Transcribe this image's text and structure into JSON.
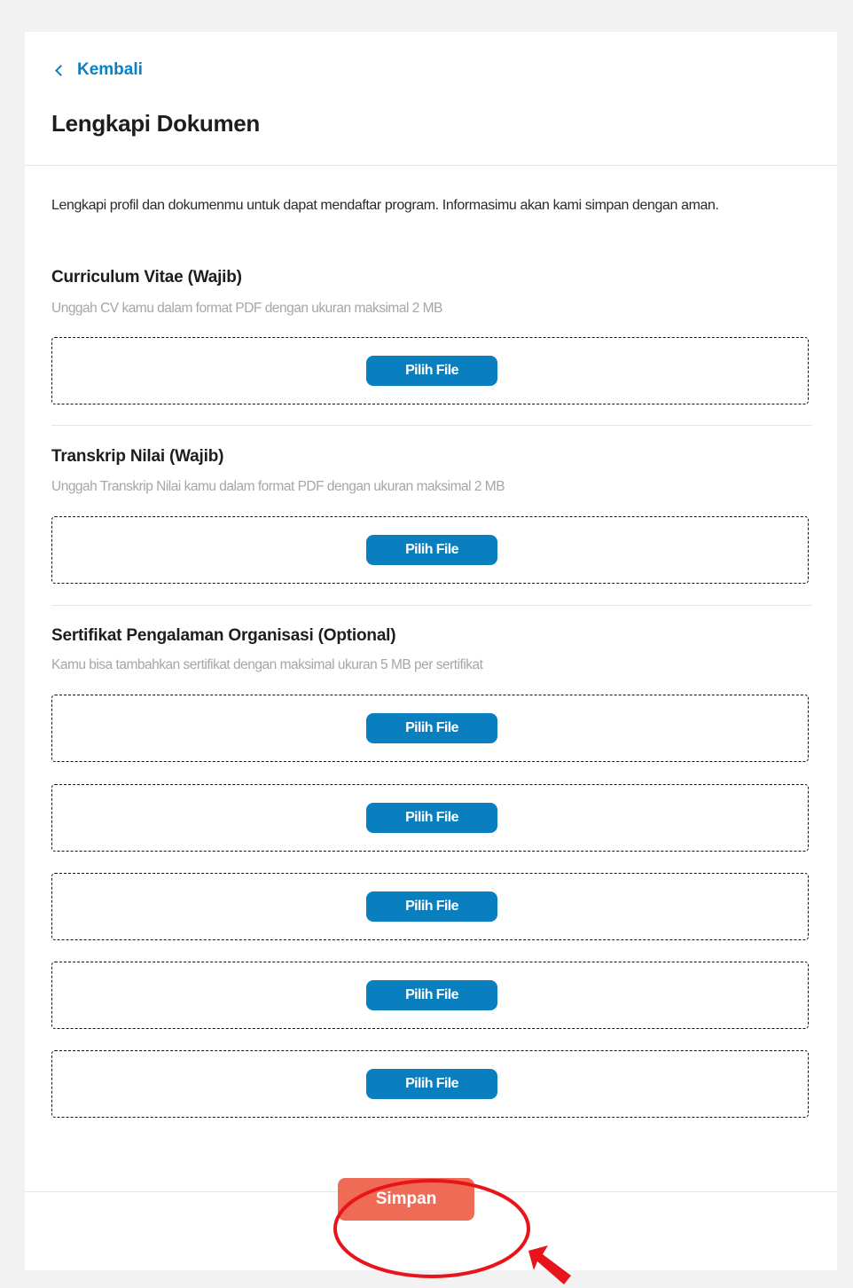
{
  "header": {
    "back_label": "Kembali",
    "title": "Lengkapi Dokumen"
  },
  "intro_text": "Lengkapi profil dan dokumenmu untuk dapat mendaftar program. Informasimu akan kami simpan dengan aman.",
  "sections": [
    {
      "title": "Curriculum Vitae (Wajib)",
      "description": "Unggah CV kamu dalam format PDF dengan ukuran maksimal 2 MB",
      "button_label": "Pilih File"
    },
    {
      "title": "Transkrip Nilai (Wajib)",
      "description": "Unggah Transkrip Nilai kamu dalam format PDF dengan ukuran maksimal 2 MB",
      "button_label": "Pilih File"
    },
    {
      "title": "Sertifikat Pengalaman Organisasi (Optional)",
      "description": "Kamu bisa tambahkan sertifikat dengan maksimal ukuran 5 MB per sertifikat",
      "button_labels": [
        "Pilih File",
        "Pilih File",
        "Pilih File",
        "Pilih File",
        "Pilih File"
      ]
    }
  ],
  "footer": {
    "save_label": "Simpan"
  },
  "annotation": {
    "highlight_color": "#e8141b"
  },
  "colors": {
    "accent": "#0a7fc0",
    "save_button": "#f06b55",
    "annotation": "#e8141b"
  },
  "icons": {
    "back": "chevron-left-icon",
    "annotation_arrow": "arrow-icon"
  }
}
